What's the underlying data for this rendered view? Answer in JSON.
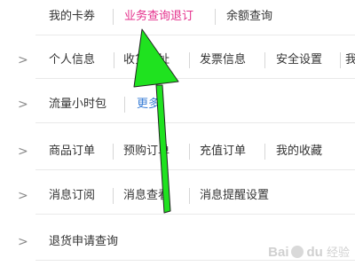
{
  "rows": [
    {
      "items": [
        "我的卡券",
        "业务查询退订",
        "余额查询"
      ],
      "active_index": 1
    },
    {
      "items": [
        "个人信息",
        "收货地址",
        "发票信息",
        "安全设置",
        "我"
      ]
    },
    {
      "items": [
        "流量小时包",
        "更多"
      ]
    },
    {
      "items": [
        "商品订单",
        "预购订单",
        "充值订单",
        "我的收藏"
      ]
    },
    {
      "items": [
        "消息订阅",
        "消息查看",
        "消息提醒设置"
      ]
    },
    {
      "items": [
        "退货申请查询"
      ]
    }
  ],
  "chevron_icon": "chevron-right-icon",
  "chevron_glyph": ">",
  "arrow_color": "#1fe21f",
  "active_color": "#e4308c",
  "watermark": {
    "brand": "Bai",
    "brand_suffix": "du",
    "sub": "经验"
  }
}
